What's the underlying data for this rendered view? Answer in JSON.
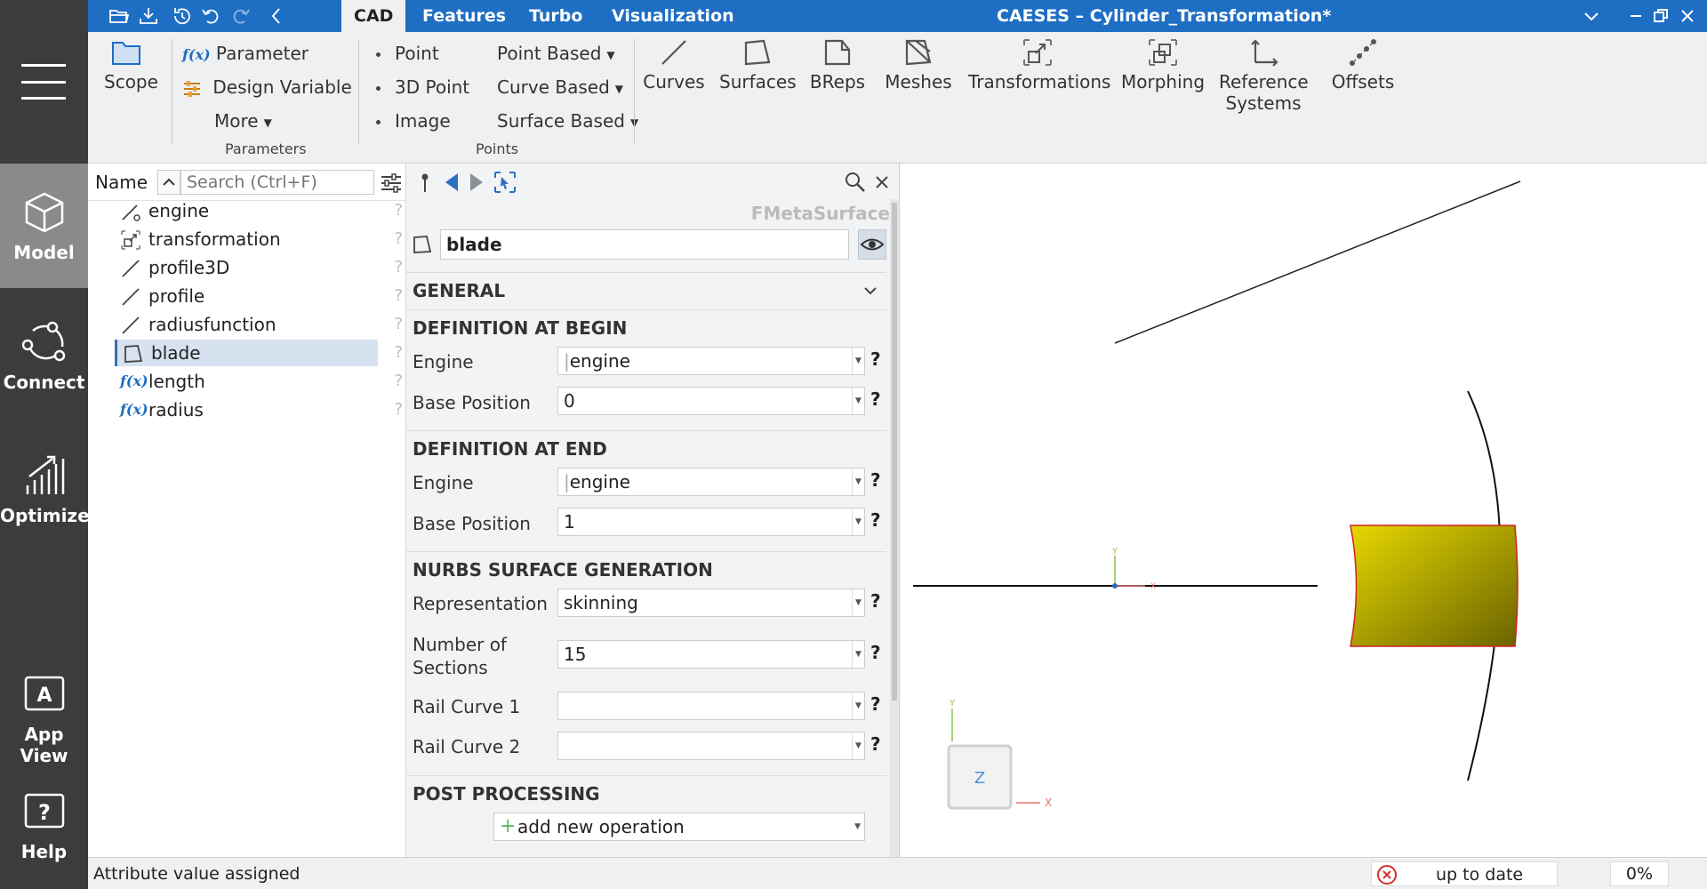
{
  "window": {
    "title": "CAESES – Cylinder_Transformation*",
    "menu_tabs": [
      "CAD",
      "Features",
      "Turbo",
      "Visualization"
    ],
    "active_tab": "CAD"
  },
  "sidebar": {
    "items": [
      {
        "label": "Model",
        "icon": "cube-icon",
        "active": true
      },
      {
        "label": "Connect",
        "icon": "connect-icon"
      },
      {
        "label": "Optimize",
        "icon": "optimize-icon"
      },
      {
        "label": "App View",
        "icon": "app-view-icon"
      },
      {
        "label": "Help",
        "icon": "help-icon"
      }
    ]
  },
  "ribbon": {
    "scope": "Scope",
    "parameter": "Parameter",
    "design_variable": "Design Variable",
    "more": "More",
    "group_parameters": "Parameters",
    "point": "Point",
    "point3d": "3D Point",
    "image": "Image",
    "point_based": "Point Based",
    "curve_based": "Curve Based",
    "surface_based": "Surface Based",
    "group_points": "Points",
    "curves": "Curves",
    "surfaces": "Surfaces",
    "breps": "BReps",
    "meshes": "Meshes",
    "transformations": "Transformations",
    "morphing": "Morphing",
    "reference_systems_1": "Reference",
    "reference_systems_2": "Systems",
    "offsets": "Offsets"
  },
  "tree": {
    "name_header": "Name",
    "search_placeholder": "Search (Ctrl+F)",
    "items": [
      {
        "label": "engine",
        "icon": "engine-curve-icon"
      },
      {
        "label": "transformation",
        "icon": "transformation-icon"
      },
      {
        "label": "profile3D",
        "icon": "curve-icon"
      },
      {
        "label": "profile",
        "icon": "curve-icon"
      },
      {
        "label": "radiusfunction",
        "icon": "curve-icon"
      },
      {
        "label": "blade",
        "icon": "surface-icon",
        "selected": true
      },
      {
        "label": "length",
        "icon": "fx-icon"
      },
      {
        "label": "radius",
        "icon": "fx-icon"
      }
    ],
    "fx": "f(x)",
    "q": "?"
  },
  "props": {
    "type": "FMetaSurface",
    "name": "blade",
    "general": "GENERAL",
    "def_begin": "DEFINITION AT BEGIN",
    "engine_label": "Engine",
    "engine_value": "engine",
    "base_pos_label": "Base Position",
    "base_pos_begin": "0",
    "def_end": "DEFINITION AT END",
    "base_pos_end": "1",
    "nurbs": "NURBS SURFACE GENERATION",
    "representation_label": "Representation",
    "representation_value": "skinning",
    "sections_label_1": "Number of",
    "sections_label_2": "Sections",
    "sections_value": "15",
    "rail1_label": "Rail Curve 1",
    "rail2_label": "Rail Curve 2",
    "post": "POST PROCESSING",
    "add_op": "add new operation",
    "q": "?"
  },
  "viewport": {
    "axis_y": "Y",
    "axis_x": "X",
    "axis_z": "Z",
    "colors": {
      "blade_light": "#e6d800",
      "blade_dark": "#6b6300",
      "edge": "#d22020"
    }
  },
  "status": {
    "message": "Attribute value assigned",
    "update": "up to date",
    "progress": "0%"
  }
}
